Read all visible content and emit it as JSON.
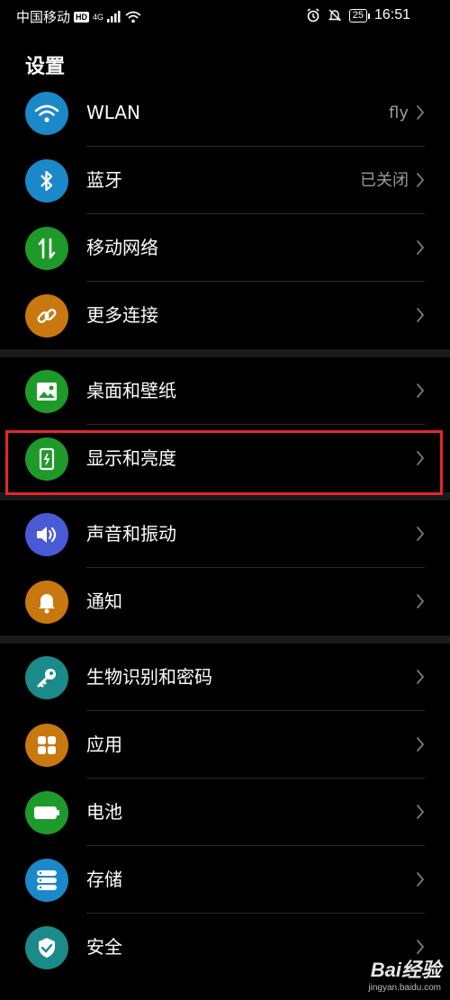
{
  "status_bar": {
    "carrier": "中国移动",
    "hd": "HD",
    "network": "4G",
    "battery": "25",
    "time": "16:51"
  },
  "page_title": "设置",
  "groups": [
    [
      {
        "id": "wlan",
        "label": "WLAN",
        "value": "fly",
        "icon": "wifi-icon",
        "color": "#1a88c9"
      },
      {
        "id": "bluetooth",
        "label": "蓝牙",
        "value": "已关闭",
        "icon": "bluetooth-icon",
        "color": "#1a88c9"
      },
      {
        "id": "mobile-network",
        "label": "移动网络",
        "value": "",
        "icon": "mobile-data-icon",
        "color": "#1e9a2b"
      },
      {
        "id": "more-connections",
        "label": "更多连接",
        "value": "",
        "icon": "link-icon",
        "color": "#c9780f"
      }
    ],
    [
      {
        "id": "home-wallpaper",
        "label": "桌面和壁纸",
        "value": "",
        "icon": "image-icon",
        "color": "#1e9a2b"
      },
      {
        "id": "display-brightness",
        "label": "显示和亮度",
        "value": "",
        "icon": "display-icon",
        "color": "#1e9a2b"
      }
    ],
    [
      {
        "id": "sound-vibration",
        "label": "声音和振动",
        "value": "",
        "icon": "speaker-icon",
        "color": "#4a5ad6"
      },
      {
        "id": "notifications",
        "label": "通知",
        "value": "",
        "icon": "bell-icon",
        "color": "#c9780f"
      }
    ],
    [
      {
        "id": "biometrics-password",
        "label": "生物识别和密码",
        "value": "",
        "icon": "key-icon",
        "color": "#1b8a8a"
      },
      {
        "id": "apps",
        "label": "应用",
        "value": "",
        "icon": "apps-icon",
        "color": "#c9780f"
      },
      {
        "id": "battery",
        "label": "电池",
        "value": "",
        "icon": "battery-icon",
        "color": "#1e9a2b"
      },
      {
        "id": "storage",
        "label": "存储",
        "value": "",
        "icon": "storage-icon",
        "color": "#1a88c9"
      },
      {
        "id": "security",
        "label": "安全",
        "value": "",
        "icon": "shield-icon",
        "color": "#1b8a8a"
      }
    ]
  ],
  "watermark": {
    "logo": "Bai经验",
    "site": "jingyan.baidu.com"
  }
}
